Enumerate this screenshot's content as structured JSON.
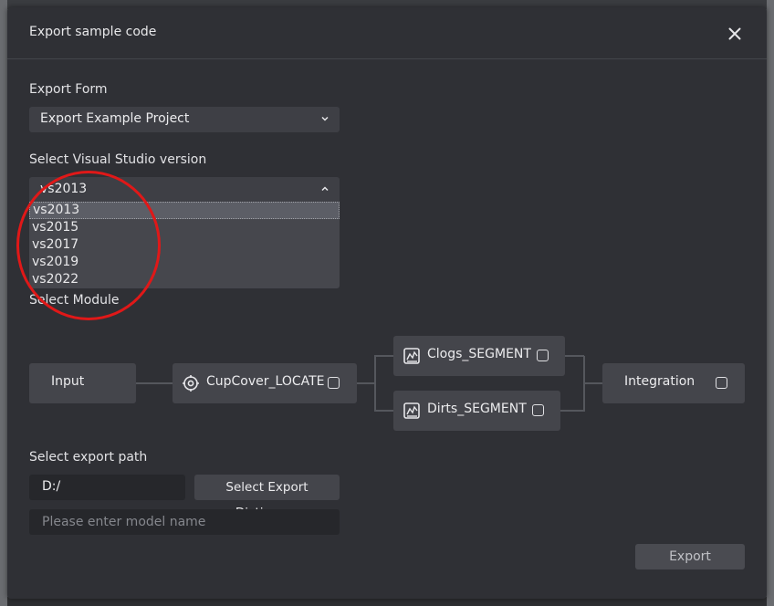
{
  "dialog": {
    "title": "Export sample code"
  },
  "export_form": {
    "label": "Export Form",
    "selected": "Export Example Project"
  },
  "vs_version": {
    "label": "Select Visual Studio version",
    "selected": "vs2013",
    "options": [
      "vs2013",
      "vs2015",
      "vs2017",
      "vs2019",
      "vs2022"
    ]
  },
  "module": {
    "label": "Select Module",
    "nodes": {
      "input": "Input",
      "locate": "CupCover_LOCATE",
      "clogs": "Clogs_SEGMENT",
      "dirts": "Dirts_SEGMENT",
      "integration": "Integration"
    }
  },
  "export_path": {
    "label": "Select export path",
    "path_value": "D:/",
    "select_button": "Select Export Dictionary",
    "model_name_placeholder": "Please enter model name"
  },
  "footer": {
    "export_button": "Export"
  },
  "colors": {
    "dialog_bg": "#2f3035",
    "control_bg": "#3e3f45",
    "highlight_circle": "#e01818"
  }
}
